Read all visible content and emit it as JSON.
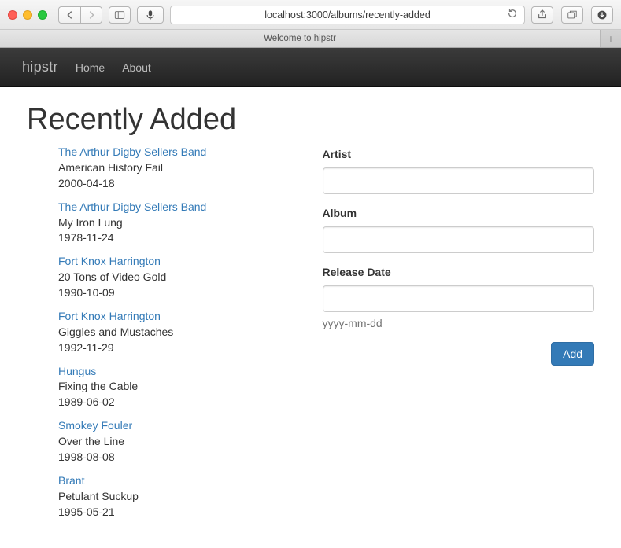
{
  "browser": {
    "url": "localhost:3000/albums/recently-added",
    "tab_title": "Welcome to hipstr"
  },
  "navbar": {
    "brand": "hipstr",
    "links": [
      "Home",
      "About"
    ]
  },
  "page": {
    "heading": "Recently Added"
  },
  "albums": [
    {
      "artist": "The Arthur Digby Sellers Band",
      "name": "American History Fail",
      "date": "2000-04-18"
    },
    {
      "artist": "The Arthur Digby Sellers Band",
      "name": "My Iron Lung",
      "date": "1978-11-24"
    },
    {
      "artist": "Fort Knox Harrington",
      "name": "20 Tons of Video Gold",
      "date": "1990-10-09"
    },
    {
      "artist": "Fort Knox Harrington",
      "name": "Giggles and Mustaches",
      "date": "1992-11-29"
    },
    {
      "artist": "Hungus",
      "name": "Fixing the Cable",
      "date": "1989-06-02"
    },
    {
      "artist": "Smokey Fouler",
      "name": "Over the Line",
      "date": "1998-08-08"
    },
    {
      "artist": "Brant",
      "name": "Petulant Suckup",
      "date": "1995-05-21"
    }
  ],
  "form": {
    "artist_label": "Artist",
    "album_label": "Album",
    "release_label": "Release Date",
    "release_help": "yyyy-mm-dd",
    "add_label": "Add"
  }
}
